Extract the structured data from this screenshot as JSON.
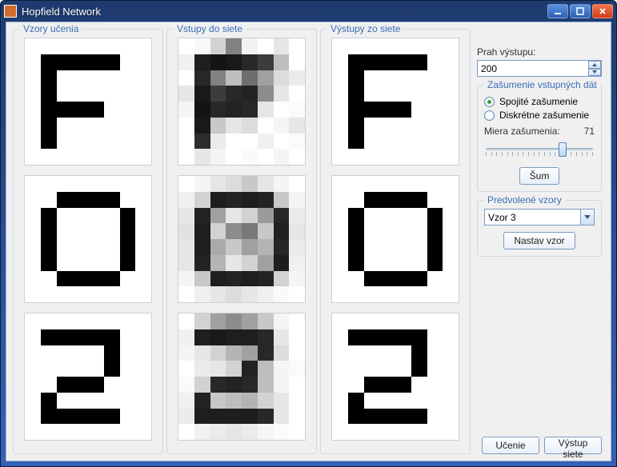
{
  "window": {
    "title": "Hopfield Network"
  },
  "columns": {
    "training_legend": "Vzory učenia",
    "input_legend": "Vstupy do siete",
    "output_legend": "Výstupy zo siete"
  },
  "threshold": {
    "label": "Prah výstupu:",
    "value": "200"
  },
  "noise": {
    "legend": "Zašumenie vstupných dát",
    "continuous_label": "Spojité zašumenie",
    "discrete_label": "Diskrétne zašumenie",
    "mode": "continuous",
    "amount_label": "Miera zašumenia:",
    "amount_value": "71",
    "noise_button": "Šum"
  },
  "presets": {
    "legend": "Predvolené vzory",
    "selected": "Vzor 3",
    "set_button": "Nastav vzor"
  },
  "buttons": {
    "train": "Učenie",
    "output": "Výstup siete"
  },
  "patterns": {
    "F": "0000000001111100010000000100000001111000010000000100000000000000",
    "O": "0000000000111100010000100100001001000010010000100011110000000000",
    "TWO": "0000000001111100000001000000010000111000010000000111110000000000"
  },
  "noisy": {
    "F": [
      255,
      248,
      210,
      130,
      242,
      255,
      230,
      255,
      240,
      30,
      20,
      25,
      40,
      60,
      190,
      255,
      255,
      40,
      130,
      190,
      110,
      160,
      220,
      235,
      230,
      25,
      60,
      40,
      35,
      140,
      230,
      255,
      245,
      20,
      40,
      35,
      40,
      230,
      255,
      250,
      255,
      25,
      200,
      230,
      220,
      255,
      245,
      230,
      255,
      45,
      235,
      255,
      255,
      240,
      255,
      250,
      255,
      230,
      245,
      255,
      250,
      255,
      245,
      255
    ],
    "O": [
      255,
      245,
      230,
      220,
      200,
      230,
      245,
      255,
      240,
      210,
      30,
      35,
      30,
      35,
      200,
      245,
      230,
      35,
      160,
      230,
      210,
      155,
      40,
      235,
      225,
      30,
      210,
      140,
      120,
      200,
      33,
      230,
      230,
      30,
      170,
      200,
      160,
      180,
      38,
      235,
      230,
      35,
      180,
      230,
      210,
      160,
      30,
      240,
      245,
      200,
      30,
      35,
      30,
      35,
      210,
      245,
      255,
      240,
      230,
      220,
      230,
      240,
      250,
      255
    ],
    "TWO": [
      255,
      210,
      160,
      140,
      160,
      200,
      245,
      255,
      240,
      30,
      25,
      30,
      30,
      40,
      230,
      255,
      245,
      230,
      210,
      180,
      160,
      40,
      220,
      255,
      255,
      235,
      230,
      210,
      35,
      190,
      245,
      250,
      250,
      210,
      40,
      35,
      40,
      190,
      245,
      255,
      240,
      35,
      200,
      190,
      180,
      210,
      230,
      255,
      235,
      30,
      30,
      30,
      30,
      40,
      230,
      255,
      255,
      240,
      235,
      230,
      235,
      245,
      250,
      255
    ]
  }
}
